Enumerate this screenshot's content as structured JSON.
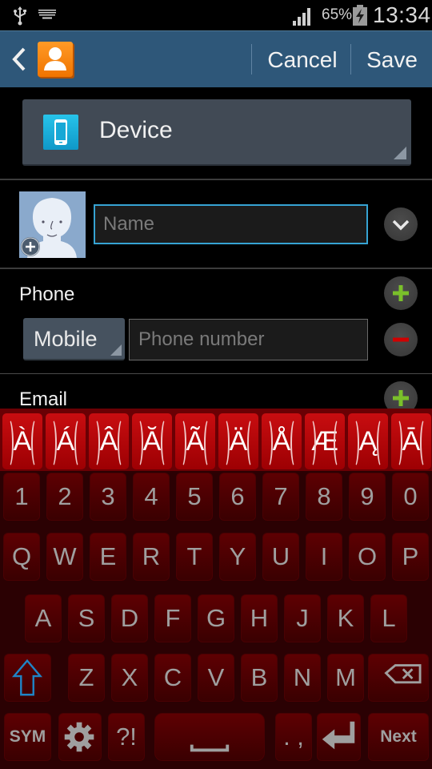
{
  "status_bar": {
    "usb_icon": "usb-icon",
    "keyboard_icon": "keyboard-icon",
    "signal_icon": "signal-icon",
    "battery_percent": "65%",
    "battery_icon": "battery-charging-icon",
    "time": "13:34"
  },
  "action_bar": {
    "back_icon": "chevron-left-icon",
    "app_icon": "contacts-icon",
    "cancel_label": "Cancel",
    "save_label": "Save"
  },
  "storage": {
    "icon": "phone-device-icon",
    "label": "Device"
  },
  "name": {
    "placeholder": "Name",
    "value": ""
  },
  "phone": {
    "section_label": "Phone",
    "type_label": "Mobile",
    "placeholder": "Phone number",
    "value": ""
  },
  "email": {
    "section_label": "Email"
  },
  "colors": {
    "action_bar": "#2e5779",
    "focus_border": "#36a3d3",
    "add_green": "#7ac02a",
    "remove_red": "#d00000",
    "keyboard_bg": "#2b0103",
    "accent_key": "#c80d10"
  },
  "keyboard": {
    "accent_row": [
      "À",
      "Á",
      "Â",
      "Ă",
      "Ã",
      "Ä",
      "Å",
      "Æ",
      "Ą",
      "Ā"
    ],
    "number_row": [
      "1",
      "2",
      "3",
      "4",
      "5",
      "6",
      "7",
      "8",
      "9",
      "0"
    ],
    "row1": [
      "Q",
      "W",
      "E",
      "R",
      "T",
      "Y",
      "U",
      "I",
      "O",
      "P"
    ],
    "row2": [
      "A",
      "S",
      "D",
      "F",
      "G",
      "H",
      "J",
      "K",
      "L"
    ],
    "row3": [
      "Z",
      "X",
      "C",
      "V",
      "B",
      "N",
      "M"
    ],
    "sym_label": "SYM",
    "punct_label": "?!",
    "period_comma_label": ". ,",
    "next_label": "Next"
  }
}
